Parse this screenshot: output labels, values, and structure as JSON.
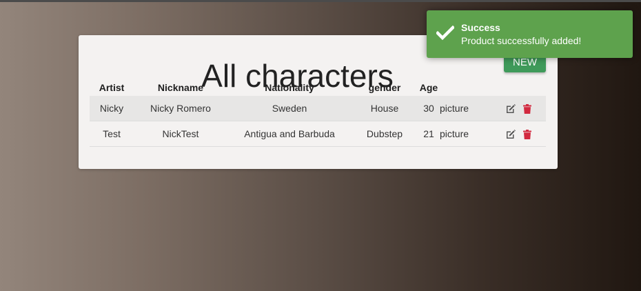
{
  "page": {
    "title": "All characters",
    "new_button": "NEW"
  },
  "table": {
    "headers": [
      "Artist",
      "Nickname",
      "Nationality",
      "gender",
      "Age",
      ""
    ],
    "rows": [
      {
        "artist": "Nicky",
        "nickname": "Nicky Romero",
        "nationality": "Sweden",
        "gender": "House",
        "age": "30",
        "picture": "picture"
      },
      {
        "artist": "Test",
        "nickname": "NickTest",
        "nationality": "Antigua and Barbuda",
        "gender": "Dubstep",
        "age": "21",
        "picture": "picture"
      }
    ]
  },
  "toast": {
    "title": "Success",
    "message": "Product successfully added!"
  },
  "icons": {
    "edit": "edit-icon",
    "delete": "trash-icon",
    "success": "checkmark-icon"
  },
  "colors": {
    "toast_bg": "#5ea24d",
    "new_button_bg": "#3f9a5a",
    "delete_icon": "#d2293f",
    "edit_icon": "#555555"
  }
}
